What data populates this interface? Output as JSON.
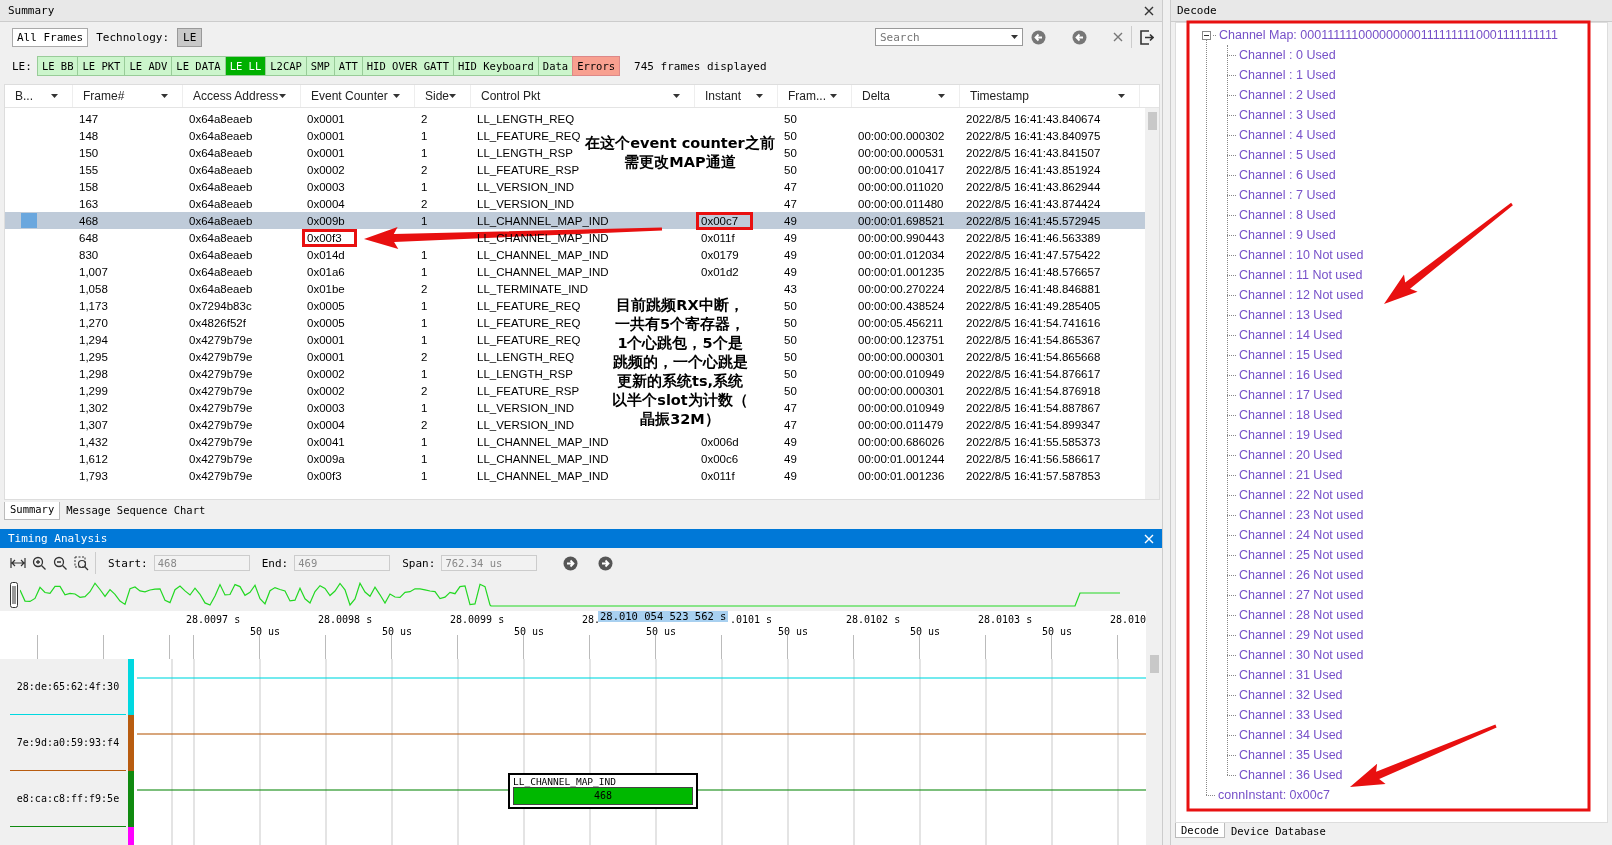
{
  "summary": {
    "title": "Summary",
    "all_frames": "All Frames",
    "technology_label": "Technology:",
    "technology": "LE",
    "search": {
      "placeholder": "Search"
    },
    "filter_label": "LE:",
    "filters": [
      {
        "label": "LE BB",
        "selected": false,
        "kind": "normal"
      },
      {
        "label": "LE PKT",
        "selected": false,
        "kind": "normal"
      },
      {
        "label": "LE ADV",
        "selected": false,
        "kind": "normal"
      },
      {
        "label": "LE DATA",
        "selected": false,
        "kind": "normal"
      },
      {
        "label": "LE LL",
        "selected": true,
        "kind": "normal"
      },
      {
        "label": "L2CAP",
        "selected": false,
        "kind": "normal"
      },
      {
        "label": "SMP",
        "selected": false,
        "kind": "normal"
      },
      {
        "label": "ATT",
        "selected": false,
        "kind": "normal"
      },
      {
        "label": "HID OVER GATT",
        "selected": false,
        "kind": "normal"
      },
      {
        "label": "HID Keyboard",
        "selected": false,
        "kind": "normal"
      },
      {
        "label": "Data",
        "selected": false,
        "kind": "normal"
      },
      {
        "label": "Errors",
        "selected": false,
        "kind": "error"
      }
    ],
    "frames_displayed": "745 frames displayed",
    "table": {
      "columns": [
        "B...",
        "Frame#",
        "Access Address",
        "Event Counter",
        "Side",
        "Control Pkt",
        "Instant",
        "Fram...",
        "Delta",
        "Timestamp"
      ],
      "rows": [
        {
          "frame": "147",
          "access_address": "0x64a8eaeb",
          "event_counter": "0x0001",
          "side": "2",
          "control_pkt": "LL_LENGTH_REQ",
          "frames": "50",
          "timestamp": "2022/8/5 16:41:43.840674",
          "selected": false
        },
        {
          "frame": "148",
          "access_address": "0x64a8eaeb",
          "event_counter": "0x0001",
          "side": "1",
          "control_pkt": "LL_FEATURE_REQ",
          "frames": "50",
          "delta": "00:00:00.000302",
          "timestamp": "2022/8/5 16:41:43.840975",
          "selected": false
        },
        {
          "frame": "150",
          "access_address": "0x64a8eaeb",
          "event_counter": "0x0001",
          "side": "1",
          "control_pkt": "LL_LENGTH_RSP",
          "frames": "50",
          "delta": "00:00:00.000531",
          "timestamp": "2022/8/5 16:41:43.841507",
          "selected": false
        },
        {
          "frame": "155",
          "access_address": "0x64a8eaeb",
          "event_counter": "0x0002",
          "side": "2",
          "control_pkt": "LL_FEATURE_RSP",
          "frames": "50",
          "delta": "00:00:00.010417",
          "timestamp": "2022/8/5 16:41:43.851924",
          "selected": false
        },
        {
          "frame": "158",
          "access_address": "0x64a8eaeb",
          "event_counter": "0x0003",
          "side": "1",
          "control_pkt": "LL_VERSION_IND",
          "frames": "47",
          "delta": "00:00:00.011020",
          "timestamp": "2022/8/5 16:41:43.862944",
          "selected": false
        },
        {
          "frame": "163",
          "access_address": "0x64a8eaeb",
          "event_counter": "0x0004",
          "side": "2",
          "control_pkt": "LL_VERSION_IND",
          "frames": "47",
          "delta": "00:00:00.011480",
          "timestamp": "2022/8/5 16:41:43.874424",
          "selected": false
        },
        {
          "frame": "468",
          "access_address": "0x64a8eaeb",
          "event_counter": "0x009b",
          "side": "1",
          "control_pkt": "LL_CHANNEL_MAP_IND",
          "instant": {
            "value": "0x00c7",
            "boxed": true
          },
          "frames": "49",
          "delta": "00:00:01.698521",
          "timestamp": "2022/8/5 16:41:45.572945",
          "selected": true
        },
        {
          "frame": "648",
          "access_address": "0x64a8eaeb",
          "event_counter": {
            "value": "0x00f3",
            "boxed": true
          },
          "control_pkt": "LL_CHANNEL_MAP_IND",
          "instant": "0x011f",
          "frames": "49",
          "delta": "00:00:00.990443",
          "timestamp": "2022/8/5 16:41:46.563389",
          "selected": false
        },
        {
          "frame": "830",
          "access_address": "0x64a8eaeb",
          "event_counter": "0x014d",
          "side": "1",
          "control_pkt": "LL_CHANNEL_MAP_IND",
          "instant": "0x0179",
          "frames": "49",
          "delta": "00:00:01.012034",
          "timestamp": "2022/8/5 16:41:47.575422",
          "selected": false
        },
        {
          "frame": "1,007",
          "access_address": "0x64a8eaeb",
          "event_counter": "0x01a6",
          "side": "1",
          "control_pkt": "LL_CHANNEL_MAP_IND",
          "instant": "0x01d2",
          "frames": "49",
          "delta": "00:00:01.001235",
          "timestamp": "2022/8/5 16:41:48.576657",
          "selected": false
        },
        {
          "frame": "1,058",
          "access_address": "0x64a8eaeb",
          "event_counter": "0x01be",
          "side": "2",
          "control_pkt": "LL_TERMINATE_IND",
          "frames": "43",
          "delta": "00:00:00.270224",
          "timestamp": "2022/8/5 16:41:48.846881",
          "selected": false
        },
        {
          "frame": "1,173",
          "access_address": "0x7294b83c",
          "event_counter": "0x0005",
          "side": "1",
          "control_pkt": "LL_FEATURE_REQ",
          "frames": "50",
          "delta": "00:00:00.438524",
          "timestamp": "2022/8/5 16:41:49.285405",
          "selected": false
        },
        {
          "frame": "1,270",
          "access_address": "0x4826f52f",
          "event_counter": "0x0005",
          "side": "1",
          "control_pkt": "LL_FEATURE_REQ",
          "frames": "50",
          "delta": "00:00:05.456211",
          "timestamp": "2022/8/5 16:41:54.741616",
          "selected": false
        },
        {
          "frame": "1,294",
          "access_address": "0x4279b79e",
          "event_counter": "0x0001",
          "side": "1",
          "control_pkt": "LL_FEATURE_REQ",
          "frames": "50",
          "delta": "00:00:00.123751",
          "timestamp": "2022/8/5 16:41:54.865367",
          "selected": false
        },
        {
          "frame": "1,295",
          "access_address": "0x4279b79e",
          "event_counter": "0x0001",
          "side": "2",
          "control_pkt": "LL_LENGTH_REQ",
          "frames": "50",
          "delta": "00:00:00.000301",
          "timestamp": "2022/8/5 16:41:54.865668",
          "selected": false
        },
        {
          "frame": "1,298",
          "access_address": "0x4279b79e",
          "event_counter": "0x0002",
          "side": "1",
          "control_pkt": "LL_LENGTH_RSP",
          "frames": "50",
          "delta": "00:00:00.010949",
          "timestamp": "2022/8/5 16:41:54.876617",
          "selected": false
        },
        {
          "frame": "1,299",
          "access_address": "0x4279b79e",
          "event_counter": "0x0002",
          "side": "2",
          "control_pkt": "LL_FEATURE_RSP",
          "frames": "50",
          "delta": "00:00:00.000301",
          "timestamp": "2022/8/5 16:41:54.876918",
          "selected": false
        },
        {
          "frame": "1,302",
          "access_address": "0x4279b79e",
          "event_counter": "0x0003",
          "side": "1",
          "control_pkt": "LL_VERSION_IND",
          "frames": "47",
          "delta": "00:00:00.010949",
          "timestamp": "2022/8/5 16:41:54.887867",
          "selected": false
        },
        {
          "frame": "1,307",
          "access_address": "0x4279b79e",
          "event_counter": "0x0004",
          "side": "2",
          "control_pkt": "LL_VERSION_IND",
          "frames": "47",
          "delta": "00:00:00.011479",
          "timestamp": "2022/8/5 16:41:54.899347",
          "selected": false
        },
        {
          "frame": "1,432",
          "access_address": "0x4279b79e",
          "event_counter": "0x0041",
          "side": "1",
          "control_pkt": "LL_CHANNEL_MAP_IND",
          "instant": "0x006d",
          "frames": "49",
          "delta": "00:00:00.686026",
          "timestamp": "2022/8/5 16:41:55.585373",
          "selected": false
        },
        {
          "frame": "1,612",
          "access_address": "0x4279b79e",
          "event_counter": "0x009a",
          "side": "1",
          "control_pkt": "LL_CHANNEL_MAP_IND",
          "instant": "0x00c6",
          "frames": "49",
          "delta": "00:00:01.001244",
          "timestamp": "2022/8/5 16:41:56.586617",
          "selected": false
        },
        {
          "frame": "1,793",
          "access_address": "0x4279b79e",
          "event_counter": "0x00f3",
          "side": "1",
          "control_pkt": "LL_CHANNEL_MAP_IND",
          "instant": "0x011f",
          "frames": "49",
          "delta": "00:00:01.001236",
          "timestamp": "2022/8/5 16:41:57.587853",
          "selected": false
        }
      ]
    }
  },
  "annotations": [
    {
      "lines": [
        "在这个event counter之前",
        "需更改MAP通道"
      ]
    },
    {
      "lines": [
        "目前跳频RX中断，",
        "一共有5个寄存器，",
        "1个心跳包，5个是",
        "跳频的，一个心跳是",
        "更新的系统ts,系统",
        "以半个slot为计数（",
        "晶振32M）"
      ]
    }
  ],
  "bottom_tabs": [
    {
      "label": "Summary",
      "selected": true
    },
    {
      "label": "Message Sequence Chart",
      "selected": false
    }
  ],
  "timing": {
    "title": "Timing Analysis",
    "start": {
      "label": "Start:",
      "value": "468"
    },
    "end": {
      "label": "End:",
      "value": "469"
    },
    "span": {
      "label": "Span:",
      "value": "762.34 us"
    },
    "ruler": {
      "major": [
        "28.0097 s",
        "28.0098 s",
        "28.0099 s",
        "28.",
        ".0101 s",
        "28.0102 s",
        "28.0103 s",
        "28.010"
      ],
      "minor": [
        "50 us",
        "50 us",
        "50 us",
        "50 us",
        "50 us",
        "50 us",
        "50 us"
      ]
    },
    "cursor": "28.010 054 523 562 s",
    "lanes": [
      {
        "address": "28:de:65:62:4f:30",
        "color": "#00d8e0"
      },
      {
        "address": "7e:9d:a0:59:93:f4",
        "color": "#b85c10"
      },
      {
        "address": "e8:ca:c8:ff:f9:5e",
        "color": "#108a10",
        "packets": [
          {
            "name": "LL_CHANNEL_MAP_IND",
            "frame": "468"
          }
        ]
      },
      {
        "color": "#ff00ff"
      }
    ]
  },
  "decode": {
    "title": "Decode",
    "tree": [
      {
        "label": "Channel Map: 0001111110000000001111111110001111111111",
        "expanded": true,
        "children": [
          {
            "label": "Channel : 0 Used"
          },
          {
            "label": "Channel : 1 Used"
          },
          {
            "label": "Channel : 2 Used"
          },
          {
            "label": "Channel : 3 Used"
          },
          {
            "label": "Channel : 4 Used"
          },
          {
            "label": "Channel : 5 Used"
          },
          {
            "label": "Channel : 6 Used"
          },
          {
            "label": "Channel : 7 Used"
          },
          {
            "label": "Channel : 8 Used"
          },
          {
            "label": "Channel : 9 Used"
          },
          {
            "label": "Channel : 10 Not used"
          },
          {
            "label": "Channel : 11 Not used"
          },
          {
            "label": "Channel : 12 Not used"
          },
          {
            "label": "Channel : 13 Used"
          },
          {
            "label": "Channel : 14 Used"
          },
          {
            "label": "Channel : 15 Used"
          },
          {
            "label": "Channel : 16 Used"
          },
          {
            "label": "Channel : 17 Used"
          },
          {
            "label": "Channel : 18 Used"
          },
          {
            "label": "Channel : 19 Used"
          },
          {
            "label": "Channel : 20 Used"
          },
          {
            "label": "Channel : 21 Used"
          },
          {
            "label": "Channel : 22 Not used"
          },
          {
            "label": "Channel : 23 Not used"
          },
          {
            "label": "Channel : 24 Not used"
          },
          {
            "label": "Channel : 25 Not used"
          },
          {
            "label": "Channel : 26 Not used"
          },
          {
            "label": "Channel : 27 Not used"
          },
          {
            "label": "Channel : 28 Not used"
          },
          {
            "label": "Channel : 29 Not used"
          },
          {
            "label": "Channel : 30 Not used"
          },
          {
            "label": "Channel : 31 Used"
          },
          {
            "label": "Channel : 32 Used"
          },
          {
            "label": "Channel : 33 Used"
          },
          {
            "label": "Channel : 34 Used"
          },
          {
            "label": "Channel : 35 Used"
          },
          {
            "label": "Channel : 36 Used"
          }
        ]
      },
      {
        "label": "connInstant: 0x00c7"
      }
    ],
    "tabs": [
      {
        "label": "Decode",
        "selected": true
      },
      {
        "label": "Device Database",
        "selected": false
      }
    ]
  }
}
